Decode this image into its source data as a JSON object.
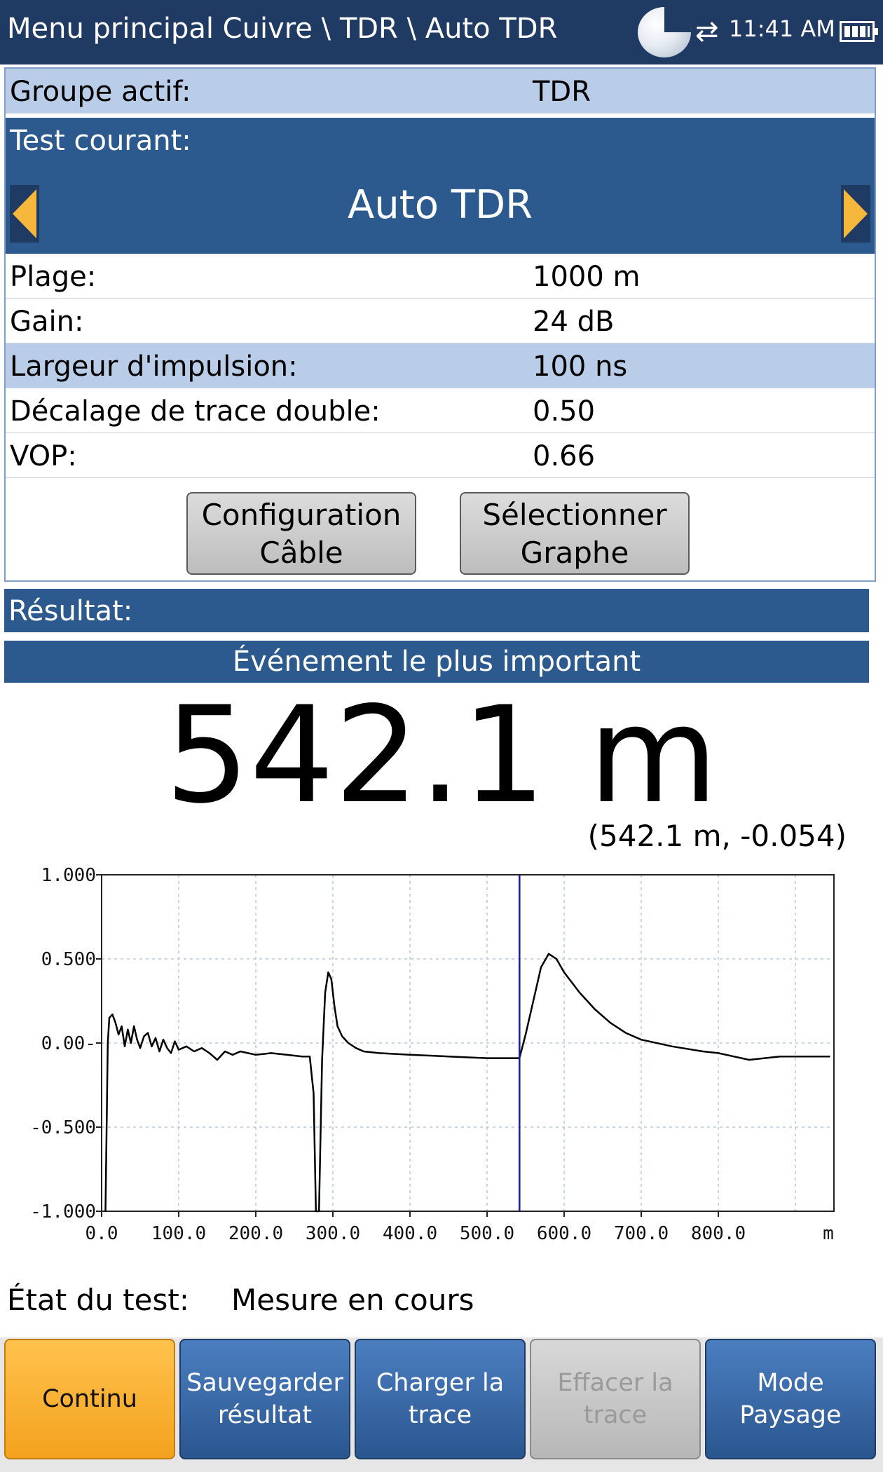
{
  "header": {
    "breadcrumb": "Menu principal Cuivre \\ TDR \\ Auto TDR",
    "time": "11:41 AM"
  },
  "config": {
    "active_group": {
      "label": "Groupe actif:",
      "value": "TDR"
    },
    "current_test": {
      "label": "Test courant:",
      "value": "Auto TDR"
    },
    "rows": [
      {
        "label": "Plage:",
        "value": "1000 m"
      },
      {
        "label": "Gain:",
        "value": "24 dB"
      },
      {
        "label": "Largeur d'impulsion:",
        "value": "100 ns"
      },
      {
        "label": "Décalage de trace double:",
        "value": "0.50"
      },
      {
        "label": "VOP:",
        "value": "0.66"
      }
    ],
    "buttons": [
      {
        "line1": "Configuration",
        "line2": "Câble"
      },
      {
        "line1": "Sélectionner",
        "line2": "Graphe"
      }
    ]
  },
  "result": {
    "header": "Résultat:",
    "event_title": "Événement le plus important",
    "big_value": "542.1 m",
    "cursor_readout": "(542.1 m, -0.054)"
  },
  "chart_data": {
    "type": "line",
    "xlabel": "m",
    "ylabel": "",
    "xlim": [
      0,
      950
    ],
    "ylim": [
      -1.0,
      1.0
    ],
    "x_ticks": [
      "0.0",
      "100.0",
      "200.0",
      "300.0",
      "400.0",
      "500.0",
      "600.0",
      "700.0",
      "800.0"
    ],
    "y_ticks": [
      "1.000",
      "0.500",
      "0.00-",
      "-0.500",
      "-1.000"
    ],
    "grid": true,
    "cursor_x": 542.1,
    "series": [
      {
        "color": "#000000",
        "x": [
          5,
          8,
          10,
          14,
          18,
          22,
          26,
          30,
          34,
          38,
          42,
          46,
          50,
          55,
          60,
          65,
          70,
          75,
          80,
          85,
          90,
          95,
          100,
          110,
          120,
          130,
          140,
          150,
          160,
          170,
          180,
          200,
          220,
          240,
          260,
          270,
          275,
          278,
          282,
          286,
          290,
          294,
          298,
          302,
          306,
          312,
          320,
          330,
          340,
          360,
          400,
          450,
          500,
          542,
          550,
          560,
          570,
          580,
          590,
          600,
          620,
          640,
          660,
          680,
          700,
          740,
          780,
          800,
          820,
          840,
          860,
          880,
          900,
          945
        ],
        "y": [
          -1.0,
          0.0,
          0.15,
          0.17,
          0.12,
          0.05,
          0.1,
          -0.02,
          0.08,
          0.0,
          0.1,
          0.02,
          -0.03,
          0.04,
          0.06,
          -0.02,
          0.03,
          -0.05,
          0.02,
          -0.03,
          -0.06,
          0.01,
          -0.04,
          -0.02,
          -0.05,
          -0.03,
          -0.06,
          -0.1,
          -0.05,
          -0.07,
          -0.05,
          -0.07,
          -0.06,
          -0.07,
          -0.08,
          -0.08,
          -0.3,
          -1.0,
          -1.0,
          -0.1,
          0.3,
          0.42,
          0.38,
          0.22,
          0.1,
          0.04,
          0.0,
          -0.03,
          -0.05,
          -0.06,
          -0.07,
          -0.08,
          -0.09,
          -0.09,
          0.05,
          0.25,
          0.45,
          0.53,
          0.5,
          0.42,
          0.3,
          0.2,
          0.12,
          0.06,
          0.02,
          -0.02,
          -0.05,
          -0.06,
          -0.08,
          -0.1,
          -0.09,
          -0.08,
          -0.08,
          -0.08
        ]
      }
    ]
  },
  "status": {
    "label": "État du test:",
    "value": "Mesure en cours"
  },
  "softkeys": [
    {
      "line1": "Continu",
      "line2": ""
    },
    {
      "line1": "Sauvegarder",
      "line2": "résultat"
    },
    {
      "line1": "Charger la",
      "line2": "trace"
    },
    {
      "line1": "Effacer la",
      "line2": "trace"
    },
    {
      "line1": "Mode",
      "line2": "Paysage"
    }
  ]
}
